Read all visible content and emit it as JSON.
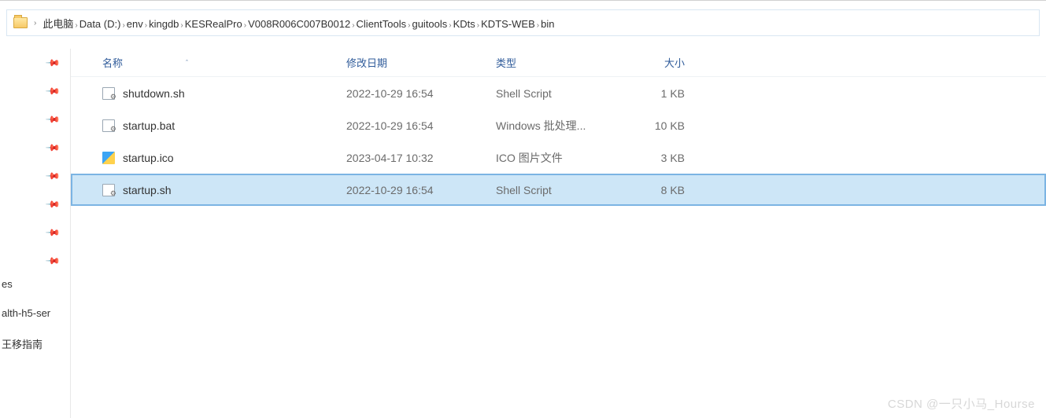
{
  "breadcrumb": {
    "items": [
      "此电脑",
      "Data (D:)",
      "env",
      "kingdb",
      "KESRealPro",
      "V008R006C007B0012",
      "ClientTools",
      "guitools",
      "KDts",
      "KDTS-WEB",
      "bin"
    ]
  },
  "columns": {
    "name": "名称",
    "date": "修改日期",
    "type": "类型",
    "size": "大小"
  },
  "files": [
    {
      "name": "shutdown.sh",
      "date": "2022-10-29 16:54",
      "type": "Shell Script",
      "size": "1 KB",
      "icon": "gear",
      "selected": false
    },
    {
      "name": "startup.bat",
      "date": "2022-10-29 16:54",
      "type": "Windows 批处理...",
      "size": "10 KB",
      "icon": "gear",
      "selected": false
    },
    {
      "name": "startup.ico",
      "date": "2023-04-17 10:32",
      "type": "ICO 图片文件",
      "size": "3 KB",
      "icon": "ico",
      "selected": false
    },
    {
      "name": "startup.sh",
      "date": "2022-10-29 16:54",
      "type": "Shell Script",
      "size": "8 KB",
      "icon": "gear",
      "selected": true
    }
  ],
  "sidebar": {
    "labels": [
      "es",
      "alth-h5-ser",
      "王移指南"
    ]
  },
  "watermark": "CSDN @一只小马_Hourse"
}
